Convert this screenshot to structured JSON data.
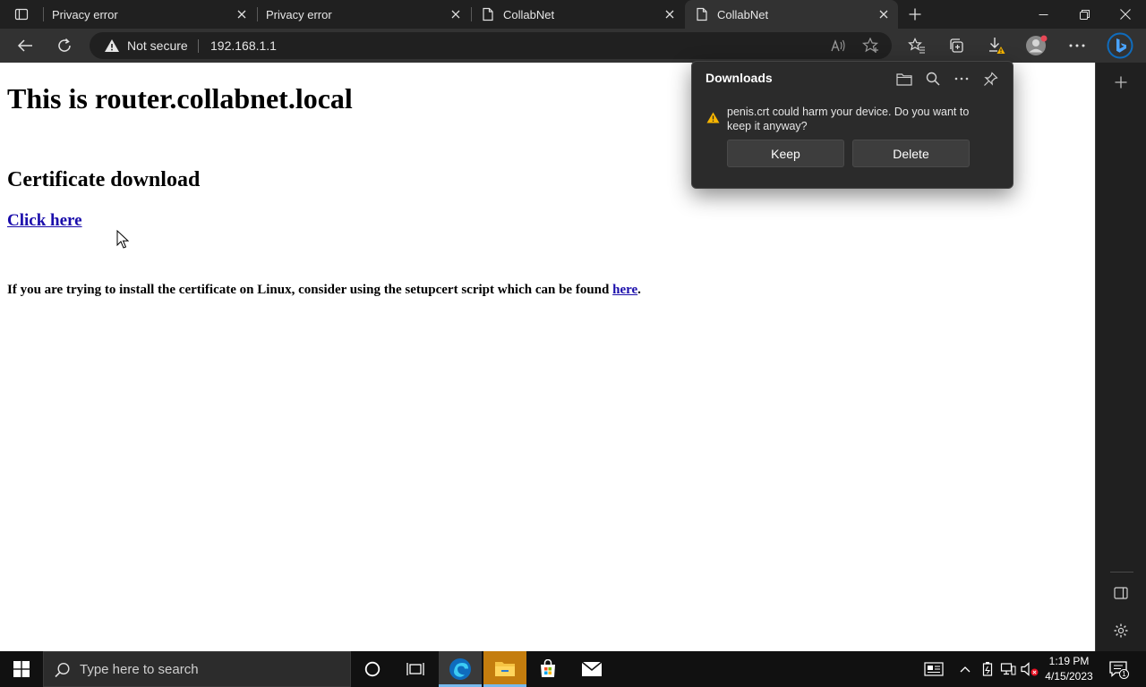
{
  "tabs": [
    {
      "label": "Privacy error"
    },
    {
      "label": "Privacy error"
    },
    {
      "label": "CollabNet"
    },
    {
      "label": "CollabNet"
    }
  ],
  "toolbar": {
    "security_label": "Not secure",
    "url": "192.168.1.1"
  },
  "page": {
    "heading": "This is router.collabnet.local",
    "subheading": "Certificate download",
    "download_link": "Click here",
    "linux_note_prefix": "If you are trying to install the certificate on Linux, consider using the setupcert script which can be found ",
    "linux_note_link": "here",
    "linux_note_suffix": "."
  },
  "downloads": {
    "title": "Downloads",
    "warning": "penis.crt could harm your device. Do you want to keep it anyway?",
    "keep_label": "Keep",
    "delete_label": "Delete"
  },
  "taskbar": {
    "search_placeholder": "Type here to search",
    "time": "1:19 PM",
    "date": "4/15/2023",
    "notification_count": "1"
  },
  "colors": {
    "link": "#1a0dab",
    "warning": "#f7b500",
    "edge_accent": "#0f6cbd",
    "chrome_dark": "#202020",
    "toolbar": "#323232"
  },
  "icons": [
    "tab-actions-icon",
    "page-icon",
    "close-icon",
    "plus-icon",
    "minimize-icon",
    "restore-icon",
    "back-icon",
    "refresh-icon",
    "warning-icon",
    "read-aloud-icon",
    "favorite-icon",
    "favorites-icon",
    "collections-icon",
    "download-icon",
    "profile-icon",
    "more-icon",
    "bing-icon",
    "folder-icon",
    "search-icon",
    "pin-icon",
    "split-screen-icon",
    "settings-icon",
    "windows-icon",
    "cortana-icon",
    "task-view-icon",
    "edge-icon",
    "file-explorer-icon",
    "store-icon",
    "mail-icon",
    "news-icon",
    "chevron-up-icon",
    "battery-icon",
    "network-icon",
    "volume-muted-icon",
    "notification-icon"
  ]
}
